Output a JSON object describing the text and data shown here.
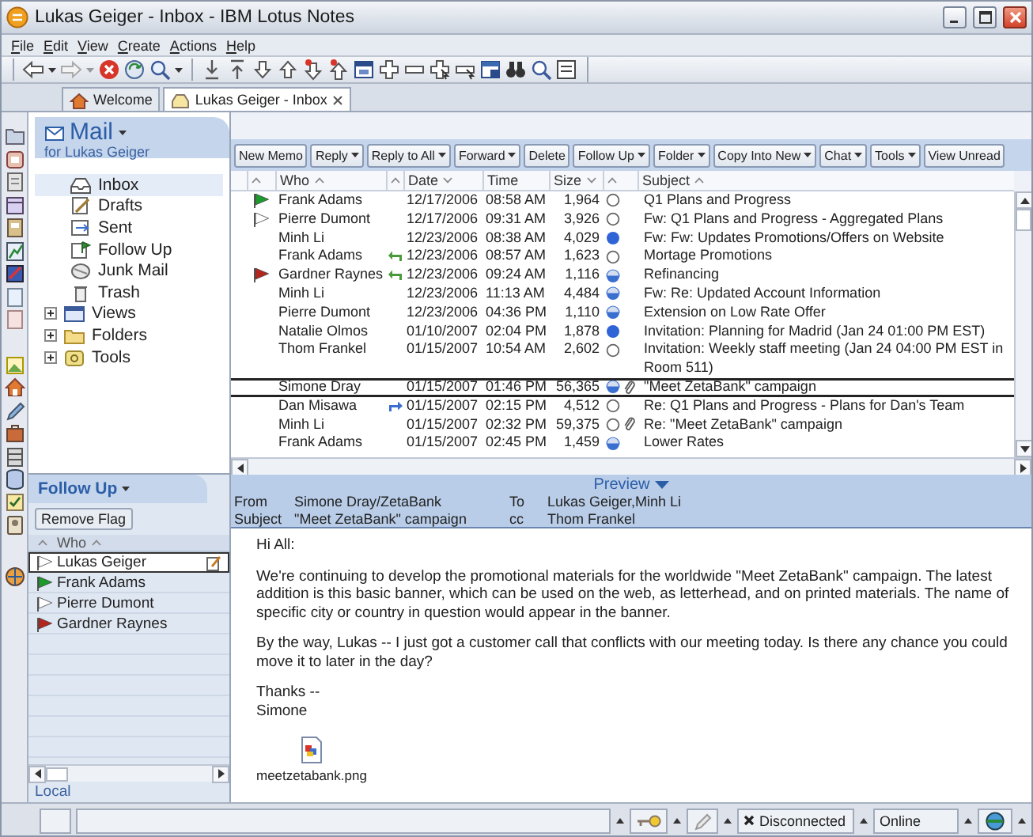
{
  "window": {
    "title": "Lukas Geiger - Inbox - IBM Lotus Notes"
  },
  "menu": [
    "File",
    "Edit",
    "View",
    "Create",
    "Actions",
    "Help"
  ],
  "tabs": [
    {
      "label": "Welcome",
      "selected": false,
      "closable": false
    },
    {
      "label": "Lukas Geiger - Inbox",
      "selected": true,
      "closable": true
    }
  ],
  "navigator": {
    "title": "Mail",
    "subtitle": "for Lukas Geiger",
    "items": [
      {
        "label": "Inbox",
        "selected": true,
        "kind": "leaf"
      },
      {
        "label": "Drafts",
        "selected": false,
        "kind": "leaf"
      },
      {
        "label": "Sent",
        "selected": false,
        "kind": "leaf"
      },
      {
        "label": "Follow Up",
        "selected": false,
        "kind": "leaf"
      },
      {
        "label": "Junk Mail",
        "selected": false,
        "kind": "leaf"
      },
      {
        "label": "Trash",
        "selected": false,
        "kind": "leaf"
      },
      {
        "label": "Views",
        "selected": false,
        "kind": "group",
        "expanded": false
      },
      {
        "label": "Folders",
        "selected": false,
        "kind": "group",
        "expanded": false
      },
      {
        "label": "Tools",
        "selected": false,
        "kind": "group",
        "expanded": false
      }
    ]
  },
  "follow_up": {
    "title": "Follow Up",
    "button": "Remove Flag",
    "columns": [
      {
        "sort": {
          "kind": "up"
        }
      },
      {
        "label": "Who",
        "sort": {
          "kind": "up"
        }
      }
    ],
    "rows": [
      {
        "name": "Lukas Geiger",
        "flag": {
          "color": "#ffffff"
        },
        "note": true,
        "selected": true
      },
      {
        "name": "Frank Adams",
        "flag": {
          "color": "#1d9a2c"
        },
        "note": false,
        "selected": false
      },
      {
        "name": "Pierre Dumont",
        "flag": {
          "color": "#ffffff"
        },
        "note": false,
        "selected": false
      },
      {
        "name": "Gardner Raynes",
        "flag": {
          "color": "#b3261e"
        },
        "note": false,
        "selected": false
      }
    ],
    "footer": "Local"
  },
  "actions": [
    {
      "label": "New Memo",
      "menu": false
    },
    {
      "label": "Reply",
      "menu": true
    },
    {
      "label": "Reply to All",
      "menu": true
    },
    {
      "label": "Forward",
      "menu": true
    },
    {
      "label": "Delete",
      "menu": false
    },
    {
      "label": "Follow Up",
      "menu": true
    },
    {
      "label": "Folder",
      "menu": true
    },
    {
      "label": "Copy Into New",
      "menu": true
    },
    {
      "label": "Chat",
      "menu": true
    },
    {
      "label": "Tools",
      "menu": true
    },
    {
      "label": "View Unread",
      "menu": false
    }
  ],
  "columns": [
    {
      "sort": {
        "kind": "up"
      }
    },
    {
      "label": "Who",
      "sort": {
        "kind": "up"
      }
    },
    {
      "sort": {
        "kind": "up"
      }
    },
    {
      "label": "Date",
      "sort": {
        "kind": "down"
      }
    },
    {
      "label": "Time"
    },
    {
      "label": "Size",
      "sort": {
        "kind": "down"
      }
    },
    {
      "sort": {
        "kind": "up"
      }
    },
    {
      "label": "Subject",
      "sort": {
        "kind": "up"
      }
    }
  ],
  "messages": [
    {
      "flag": {
        "color": "#1d9a2c"
      },
      "who": "Frank Adams",
      "date": "12/17/2006",
      "time": "08:58 AM",
      "size": "1,964",
      "status": {
        "kind": "empty"
      },
      "attachment": false,
      "subject": "Q1 Plans and Progress",
      "selected": false
    },
    {
      "flag": {
        "color": "#ffffff"
      },
      "who": "Pierre Dumont",
      "date": "12/17/2006",
      "time": "09:31 AM",
      "size": "3,926",
      "status": {
        "kind": "empty"
      },
      "attachment": false,
      "subject": "Fw: Q1 Plans and Progress - Aggregated Plans",
      "selected": false
    },
    {
      "who": "Minh Li",
      "date": "12/23/2006",
      "time": "08:38 AM",
      "size": "4,029",
      "status": {
        "kind": "full"
      },
      "attachment": false,
      "subject": "Fw: Fw: Updates Promotions/Offers on Website",
      "selected": false
    },
    {
      "who": "Frank Adams",
      "reply": {
        "kind": "replied"
      },
      "date": "12/23/2006",
      "time": "08:57 AM",
      "size": "1,623",
      "status": {
        "kind": "empty"
      },
      "attachment": false,
      "subject": "Mortage Promotions",
      "selected": false
    },
    {
      "flag": {
        "color": "#b3261e"
      },
      "who": "Gardner Raynes",
      "reply": {
        "kind": "replied"
      },
      "date": "12/23/2006",
      "time": "09:24 AM",
      "size": "1,116",
      "status": {
        "kind": "half"
      },
      "attachment": false,
      "subject": "Refinancing",
      "selected": false
    },
    {
      "who": "Minh Li",
      "date": "12/23/2006",
      "time": "11:13 AM",
      "size": "4,484",
      "status": {
        "kind": "half"
      },
      "attachment": false,
      "subject": "Fw: Re: Updated Account Information",
      "selected": false
    },
    {
      "who": "Pierre Dumont",
      "date": "12/23/2006",
      "time": "04:36 PM",
      "size": "1,110",
      "status": {
        "kind": "half"
      },
      "attachment": false,
      "subject": "Extension on Low Rate Offer",
      "selected": false
    },
    {
      "who": "Natalie Olmos",
      "date": "01/10/2007",
      "time": "02:04 PM",
      "size": "1,878",
      "status": {
        "kind": "full"
      },
      "attachment": false,
      "subject": "Invitation: Planning for Madrid (Jan 24 01:00 PM EST)",
      "selected": false
    },
    {
      "who": "Thom Frankel",
      "date": "01/15/2007",
      "time": "10:54 AM",
      "size": "2,602",
      "status": {
        "kind": "empty"
      },
      "attachment": false,
      "subject": "Invitation: Weekly staff meeting (Jan 24 04:00 PM EST in Room 511)",
      "selected": false
    },
    {
      "who": "Simone Dray",
      "date": "01/15/2007",
      "time": "01:46 PM",
      "size": "56,365",
      "status": {
        "kind": "half"
      },
      "attachment": true,
      "subject": "\"Meet ZetaBank\" campaign",
      "selected": true
    },
    {
      "who": "Dan Misawa",
      "reply": {
        "kind": "forwarded"
      },
      "date": "01/15/2007",
      "time": "02:15 PM",
      "size": "4,512",
      "status": {
        "kind": "empty"
      },
      "attachment": false,
      "subject": "Re: Q1 Plans and Progress - Plans for Dan's Team",
      "selected": false
    },
    {
      "who": "Minh Li",
      "date": "01/15/2007",
      "time": "02:32 PM",
      "size": "59,375",
      "status": {
        "kind": "empty"
      },
      "attachment": true,
      "subject": "Re: \"Meet ZetaBank\" campaign",
      "selected": false
    },
    {
      "who": "Frank Adams",
      "date": "01/15/2007",
      "time": "02:45 PM",
      "size": "1,459",
      "status": {
        "kind": "half"
      },
      "attachment": false,
      "subject": "Lower Rates",
      "selected": false
    }
  ],
  "preview": {
    "title": "Preview",
    "fields": [
      {
        "label": "From",
        "value": "Simone Dray/ZetaBank"
      },
      {
        "label": "To",
        "value": "Lukas Geiger,Minh Li"
      },
      {
        "label": "Subject",
        "value": "\"Meet ZetaBank\" campaign"
      },
      {
        "label": "cc",
        "value": "Thom Frankel"
      }
    ],
    "body": [
      [
        "Hi All:"
      ],
      [
        "We're continuing to develop the promotional materials for the worldwide \"Meet ZetaBank\" campaign. The latest addition is this basic banner, which can be used on the web, as letterhead, and on printed materials. The name of specific city or country in question would appear in the banner."
      ],
      [
        "By the way, Lukas -- I just got a customer call that conflicts with our meeting today. Is there any chance you could move it to later in the day?"
      ],
      [
        "Thanks --",
        "Simone"
      ]
    ],
    "attachment": "meetzetabank.png"
  },
  "status_bar": {
    "connection": "Disconnected",
    "location": "Online"
  }
}
